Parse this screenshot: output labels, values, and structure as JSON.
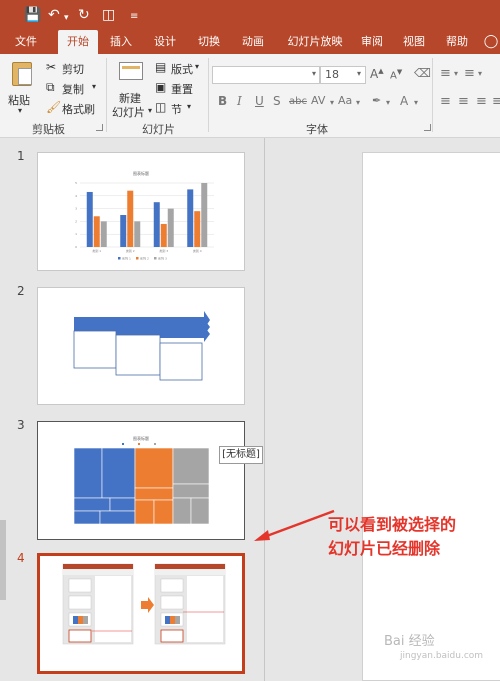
{
  "tabs": [
    "文件",
    "开始",
    "插入",
    "设计",
    "切换",
    "动画",
    "幻灯片放映",
    "审阅",
    "视图",
    "帮助"
  ],
  "active_tab": 1,
  "ribbon": {
    "paste": "粘贴",
    "cut": "剪切",
    "copy": "复制",
    "format_painter": "格式刷",
    "clipboard_group": "剪贴板",
    "new_slide_1": "新建",
    "new_slide_2": "幻灯片",
    "layout": "版式",
    "reset": "重置",
    "section": "节",
    "slides_group": "幻灯片",
    "font_size": "18",
    "font_group": "字体"
  },
  "slides": [
    {
      "num": "1",
      "title": "图表标题"
    },
    {
      "num": "2"
    },
    {
      "num": "3",
      "title": "图表标题"
    },
    {
      "num": "4"
    }
  ],
  "tooltip": "[无标题]",
  "annotation": {
    "line1": "可以看到被选择的",
    "line2": "幻灯片已经删除"
  },
  "watermark": {
    "brand": "Bai 经验",
    "url": "jingyan.baidu.com"
  },
  "colors": {
    "accent": "#b7472a",
    "annotation": "#e4352b",
    "blue": "#4472c4",
    "orange": "#ed7d31",
    "gray": "#a5a5a5"
  },
  "chart_data": {
    "type": "bar",
    "categories": [
      "类别 1",
      "类别 2",
      "类别 3",
      "类别 4"
    ],
    "series": [
      {
        "name": "系列 1",
        "values": [
          4.3,
          2.5,
          3.5,
          4.5
        ]
      },
      {
        "name": "系列 2",
        "values": [
          2.4,
          4.4,
          1.8,
          2.8
        ]
      },
      {
        "name": "系列 3",
        "values": [
          2,
          2,
          3,
          5
        ]
      }
    ],
    "title": "图表标题",
    "ylim": [
      0,
      5
    ],
    "grid": true,
    "legend": "bottom"
  }
}
